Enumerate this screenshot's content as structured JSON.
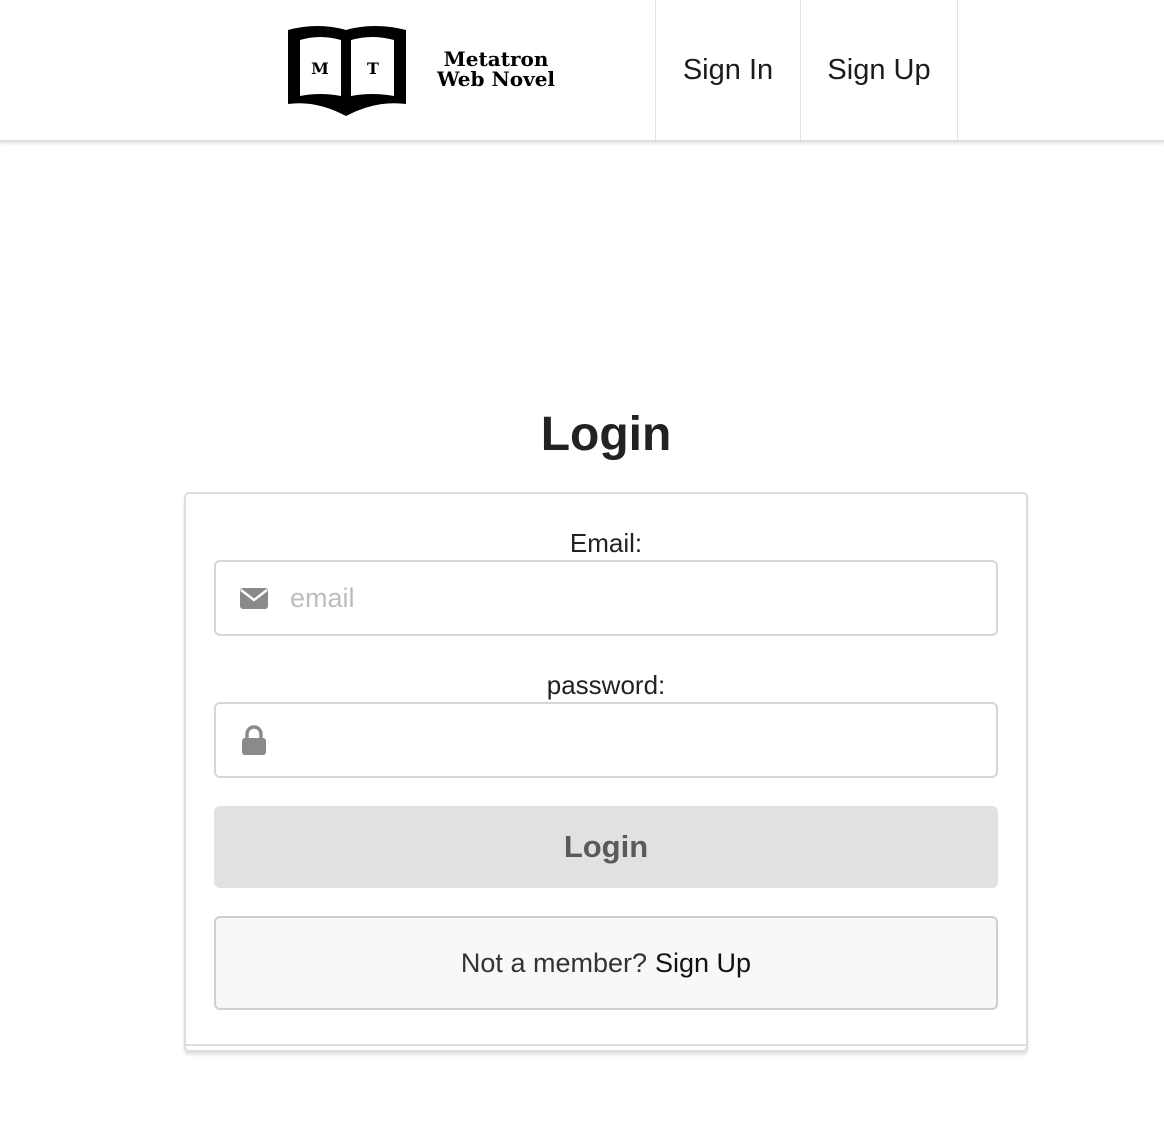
{
  "header": {
    "logo": {
      "left_letter": "M",
      "right_letter": "T",
      "line1": "Metatron",
      "line2": "Web Novel"
    },
    "nav": {
      "sign_in": "Sign In",
      "sign_up": "Sign Up"
    }
  },
  "main": {
    "title": "Login",
    "form": {
      "email_label": "Email:",
      "email_placeholder": "email",
      "email_value": "",
      "email_icon": "envelope-icon",
      "password_label": "password:",
      "password_placeholder": "",
      "password_value": "",
      "password_icon": "lock-icon",
      "submit_label": "Login"
    },
    "message": {
      "text": "Not a member?",
      "link": "Sign Up"
    }
  },
  "colors": {
    "button_bg": "#e0e1e2",
    "message_bg": "#f8f8f8",
    "icon": "#8a8a8a",
    "placeholder": "#bdbdbd"
  }
}
